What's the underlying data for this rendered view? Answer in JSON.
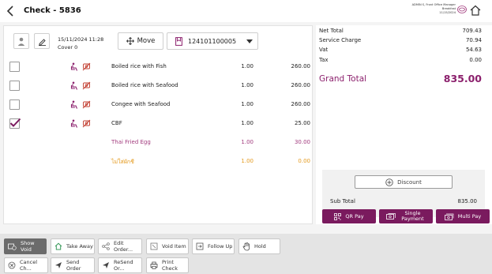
{
  "header": {
    "title": "Check - 5836",
    "user_role": "ADMIN S, Front Office Manager",
    "meal_period": "Breakfast",
    "date": "11/15/2024"
  },
  "toolbar": {
    "datetime": "15/11/2024 11:28",
    "cover": "Cover 0",
    "move_label": "Move",
    "table_number": "124101100005"
  },
  "items": [
    {
      "name": "Boiled rice with Fish",
      "qty": "1.00",
      "price": "260.00",
      "checked": false,
      "style": "normal"
    },
    {
      "name": "Boiled rice with Seafood",
      "qty": "1.00",
      "price": "260.00",
      "checked": false,
      "style": "normal"
    },
    {
      "name": "Congee with Seafood",
      "qty": "1.00",
      "price": "260.00",
      "checked": false,
      "style": "normal"
    },
    {
      "name": "CBF",
      "qty": "1.00",
      "price": "25.00",
      "checked": true,
      "style": "normal"
    },
    {
      "name": "Thai Fried Egg",
      "qty": "1.00",
      "price": "30.00",
      "checked": false,
      "style": "purple"
    },
    {
      "name": "ไม่ใส่ผักชี",
      "qty": "1.00",
      "price": "0.00",
      "checked": false,
      "style": "orange"
    }
  ],
  "summary": {
    "net_total_label": "Net Total",
    "net_total": "709.43",
    "service_charge_label": "Service Charge",
    "service_charge": "70.94",
    "vat_label": "Vat",
    "vat": "54.63",
    "tax_label": "Tax",
    "tax": "0.00",
    "grand_total_label": "Grand Total",
    "grand_total": "835.00",
    "discount_label": "Discount",
    "sub_total_label": "Sub Total",
    "sub_total": "835.00"
  },
  "payments": {
    "qr_label": "QR Pay",
    "single_label": "Single Payment",
    "multi_label": "Multi Pay"
  },
  "actions": {
    "show_void": "Show Void",
    "take_away": "Take Away",
    "edit_order": "Edit Order...",
    "void_item": "Void Item",
    "follow_up": "Follow Up",
    "hold": "Hold",
    "cancel_check": "Cancel Ch...",
    "send_order": "Send Order",
    "resend_order": "ReSend Or...",
    "print_check": "Print Check"
  },
  "colors": {
    "accent_purple": "#7a1a5e",
    "grand_total": "#8b1f6c",
    "modifier_purple": "#a13a7d",
    "modifier_orange": "#e49a1e",
    "icon_purple": "#8b1f6c",
    "icon_red": "#c0392b"
  }
}
